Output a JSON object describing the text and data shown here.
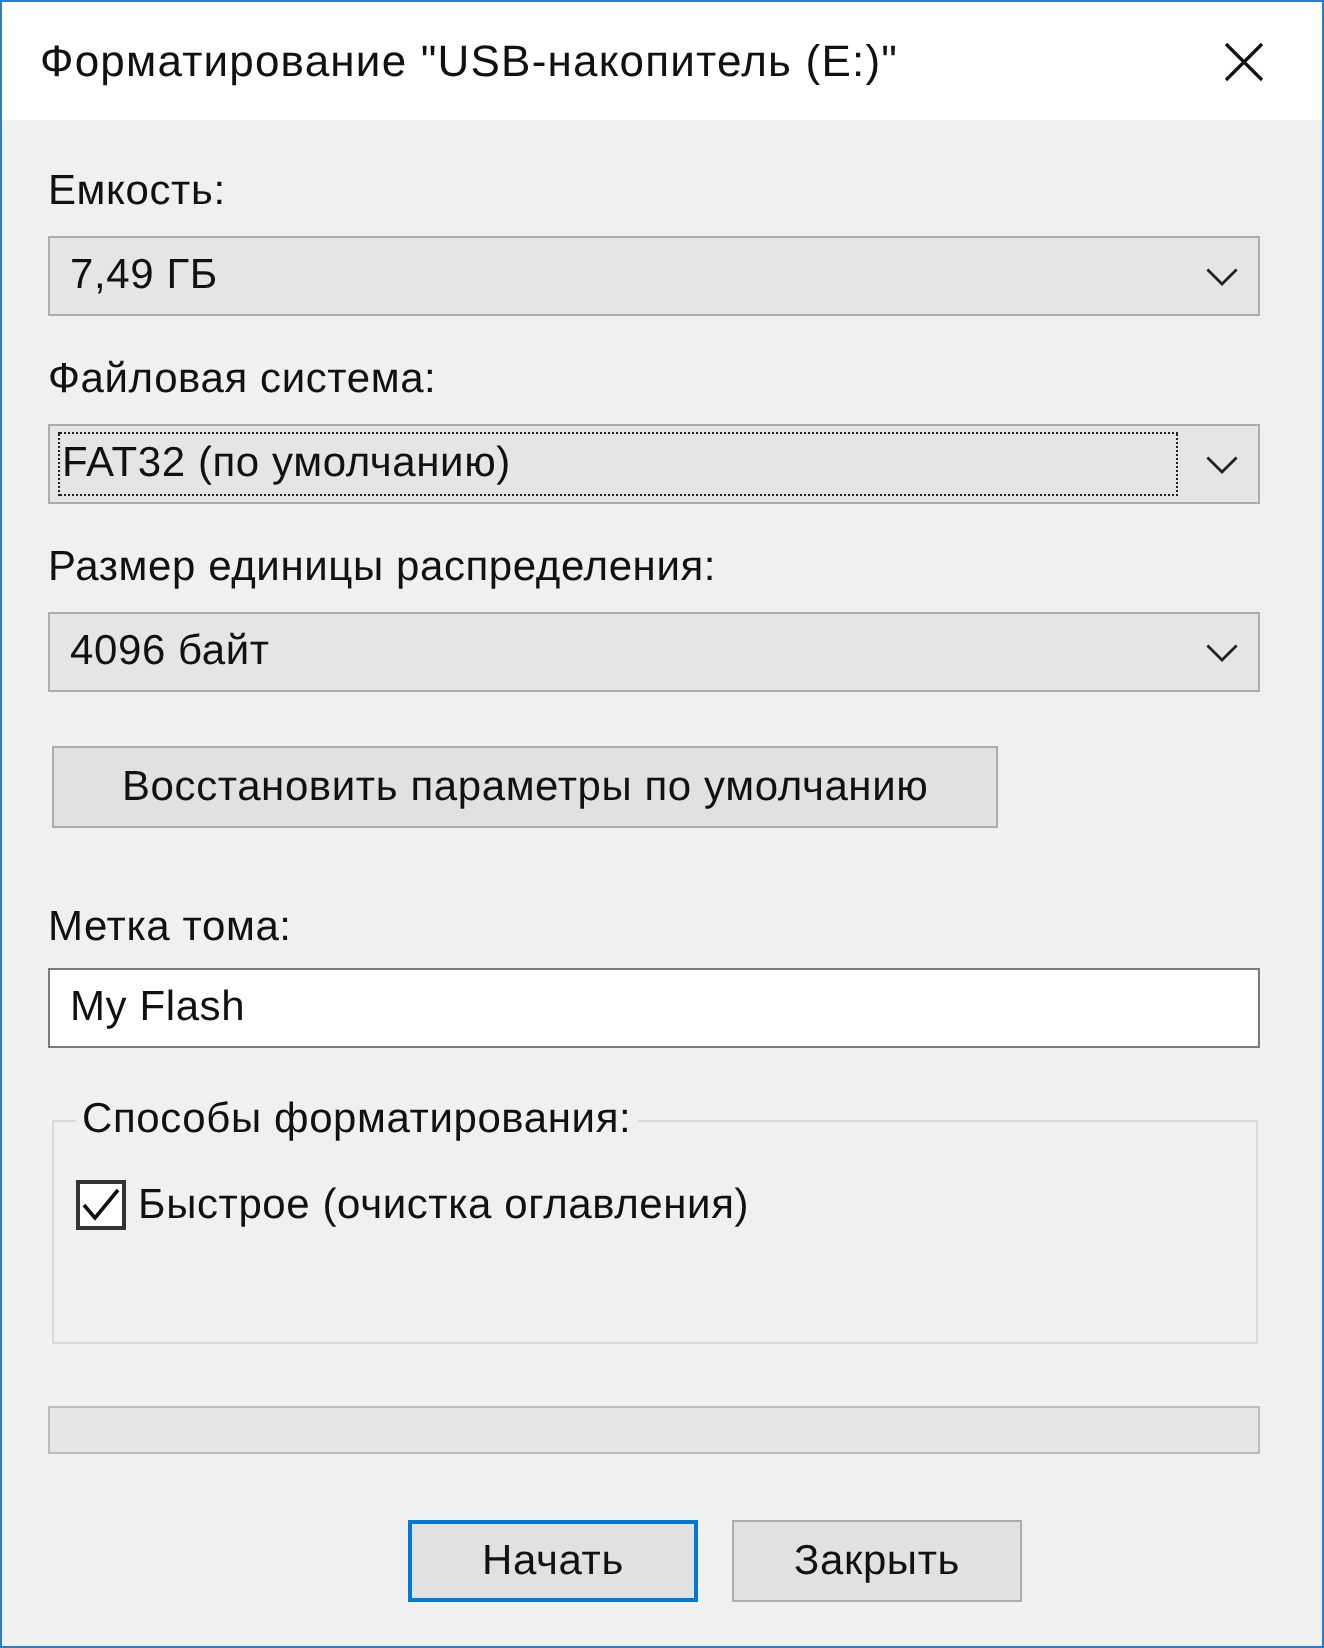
{
  "window": {
    "title": "Форматирование \"USB-накопитель (E:)\""
  },
  "fields": [
    {
      "kind": "dropdown",
      "label": "Емкость:",
      "value": "7,49 ГБ",
      "focused": false
    },
    {
      "kind": "dropdown",
      "label": "Файловая система:",
      "value": "FAT32 (по умолчанию)",
      "focused": true
    },
    {
      "kind": "dropdown",
      "label": "Размер единицы распределения:",
      "value": "4096 байт",
      "focused": false
    },
    {
      "kind": "button",
      "label": "Восстановить параметры по умолчанию"
    },
    {
      "kind": "text",
      "label": "Метка тома:",
      "value": "My Flash"
    }
  ],
  "format_options": {
    "title": "Способы форматирования:",
    "options": [
      {
        "label": "Быстрое (очистка оглавления)",
        "checked": true
      }
    ]
  },
  "progress": {
    "level": 0
  },
  "buttons": [
    {
      "label": "Начать",
      "default": true
    },
    {
      "label": "Закрыть",
      "default": false
    }
  ]
}
